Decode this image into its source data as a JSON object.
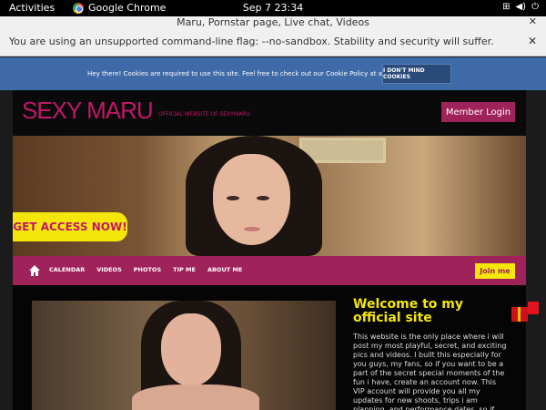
{
  "system_bar": {
    "activities": "Activities",
    "app_name": "Google Chrome",
    "clock": "Sep 7  23:34"
  },
  "window": {
    "title": "Maru, Pornstar page, Live chat, Videos"
  },
  "infobar": {
    "message": "You are using an unsupported command-line flag: --no-sandbox. Stability and security will suffer."
  },
  "cookie_banner": {
    "text": "Hey there! Cookies are required to use this site. Feel free to check out our Cookie Policy at any time.",
    "button": "I DON'T MIND COOKIES"
  },
  "site": {
    "brand": "SEXY MARU",
    "tagline": "OFFICIAL WEBSITE OF SEXYMARU",
    "member_login": "Member Login",
    "get_access": "GET ACCESS NOW!",
    "nav": [
      "CALENDAR",
      "VIDEOS",
      "PHOTOS",
      "TIP ME",
      "ABOUT ME"
    ],
    "join": "Join me",
    "welcome_title": "Welcome to my official site",
    "description": "This website is the only place where i will post my most playful, secret, and exciting pics and videos. I built this especially for you guys, my fans, so if you want to be a part of the secret special moments of the fun i have, create an account now. This VIP account will provide you all my updates for new shoots, trips i am planning, and performance dates, so if you wanna keep up"
  },
  "colors": {
    "brand": "#c0186a",
    "nav_bg": "#a0225a",
    "accent_yellow": "#f5e60a",
    "cookie_bg": "#3f6aa8"
  }
}
